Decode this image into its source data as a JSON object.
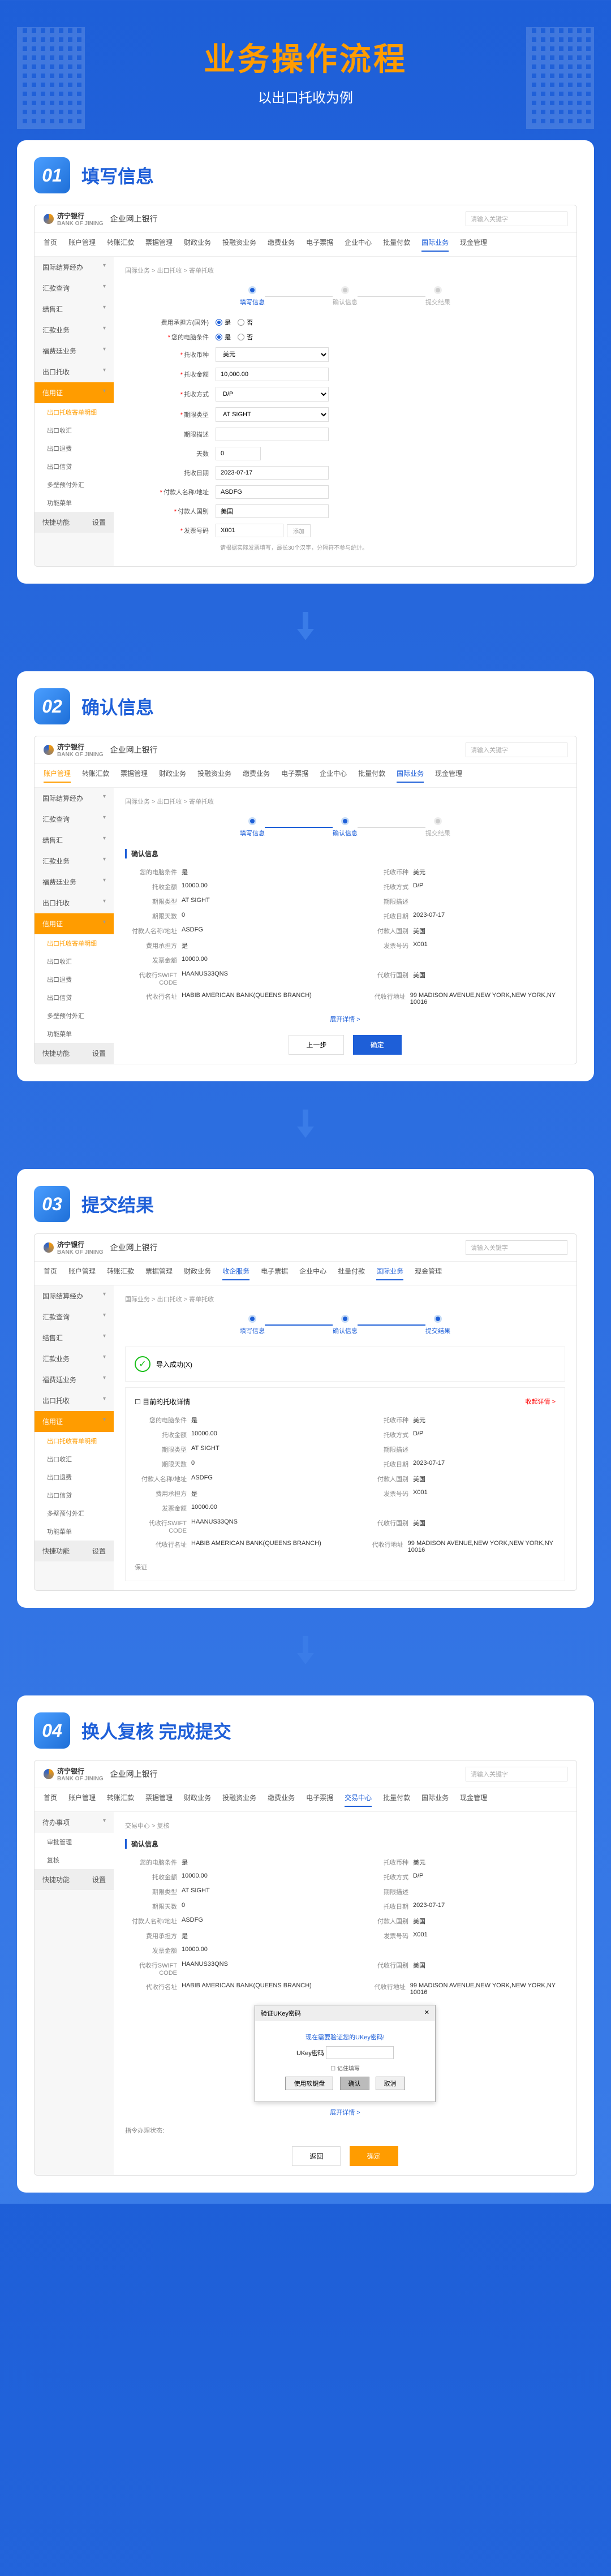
{
  "hero": {
    "title": "业务操作流程",
    "subtitle": "以出口托收为例"
  },
  "steps": [
    {
      "num": "01",
      "title": "填写信息"
    },
    {
      "num": "02",
      "title": "确认信息"
    },
    {
      "num": "03",
      "title": "提交结果"
    },
    {
      "num": "04",
      "title": "换人复核 完成提交"
    }
  ],
  "bank": {
    "name": "济宁银行",
    "en": "BANK OF JINING",
    "sys": "企业网上银行"
  },
  "search_ph": "请输入关键字",
  "nav": [
    "首页",
    "账户管理",
    "转账汇款",
    "票据管理",
    "财政业务",
    "投融资业务",
    "缴费业务",
    "电子票据",
    "企业中心",
    "批量付款",
    "国际业务",
    "现金管理"
  ],
  "nav_active": "国际业务",
  "nav2_active": "交易中心",
  "sidebar": {
    "items": [
      "国际结算经办",
      "汇款查询",
      "结售汇",
      "汇款业务",
      "福费廷业务",
      "出口托收"
    ],
    "active_parent": "信用证",
    "subs": [
      "出口托收寄单明细",
      "出口收汇",
      "出口退费",
      "出口信贷",
      "多壁预付外汇",
      "功能菜单"
    ],
    "foot": "快捷功能",
    "foot_badge": "设置"
  },
  "breadcrumb": "国际业务 > 出口托收 > 寄单托收",
  "stepper": [
    "填写信息",
    "确认信息",
    "提交结果"
  ],
  "form": {
    "f1_label": "费用承担方(国外)",
    "f1_opts": [
      "是",
      "否"
    ],
    "f2_label": "您的电脑条件",
    "f2_opts": [
      "是",
      "否"
    ],
    "f3_label": "托收币种",
    "f3_val": "美元",
    "f4_label": "托收金额",
    "f4_val": "10,000.00",
    "f5_label": "托收方式",
    "f5_val": "D/P",
    "f6_label": "期限类型",
    "f6_val": "AT SIGHT",
    "f7_label": "期限描述",
    "f7_val": "",
    "f8_label": "天数",
    "f8_val": "0",
    "f9_label": "托收日期",
    "f9_val": "2023-07-17",
    "f10_label": "付款人名称/地址",
    "f10_val": "ASDFG",
    "f11_label": "付款人国别",
    "f11_val": "美国",
    "f12_label": "发票号码",
    "f12_val": "X001",
    "f12_hint": "请根据实际发票填写，最长30个汉字，分隔符不参与统计。",
    "f12_add": "添加"
  },
  "confirm": {
    "title": "确认信息",
    "rows": [
      [
        "您的电脑条件",
        "是",
        "托收币种",
        "美元"
      ],
      [
        "托收金额",
        "10000.00",
        "托收方式",
        "D/P"
      ],
      [
        "期限类型",
        "AT SIGHT",
        "期限描述",
        ""
      ],
      [
        "期限天数",
        "0",
        "托收日期",
        "2023-07-17"
      ],
      [
        "付款人名称/地址",
        "ASDFG",
        "付款人国别",
        "美国"
      ],
      [
        "费用承担方",
        "是",
        "发票号码",
        "X001"
      ],
      [
        "发票金额",
        "10000.00",
        "",
        ""
      ],
      [
        "代收行SWIFT CODE",
        "HAANUS33QNS",
        "代收行国别",
        "美国"
      ],
      [
        "代收行名址",
        "HABIB AMERICAN BANK(QUEENS BRANCH)",
        "代收行地址",
        "99 MADISON AVENUE,NEW YORK,NEW YORK,NY 10016"
      ]
    ],
    "more": "展开详情 >",
    "btn_back": "上一步",
    "btn_submit": "确定"
  },
  "result": {
    "success": "导入成功(X)",
    "detail_title": "目前的托收详情",
    "more_r": "收起详情 >",
    "extra": "保证"
  },
  "dialog": {
    "title": "验证UKey密码",
    "close": "✕",
    "prompt": "现在需要验证您的UKey密码!",
    "label": "UKey密码",
    "soft_kb": "使用软键盘",
    "remember": "记住填写",
    "ok": "确认",
    "cancel": "取消"
  },
  "step4": {
    "result_label": "指令办理状态:",
    "btn_back": "返回",
    "btn_ok": "确定"
  }
}
